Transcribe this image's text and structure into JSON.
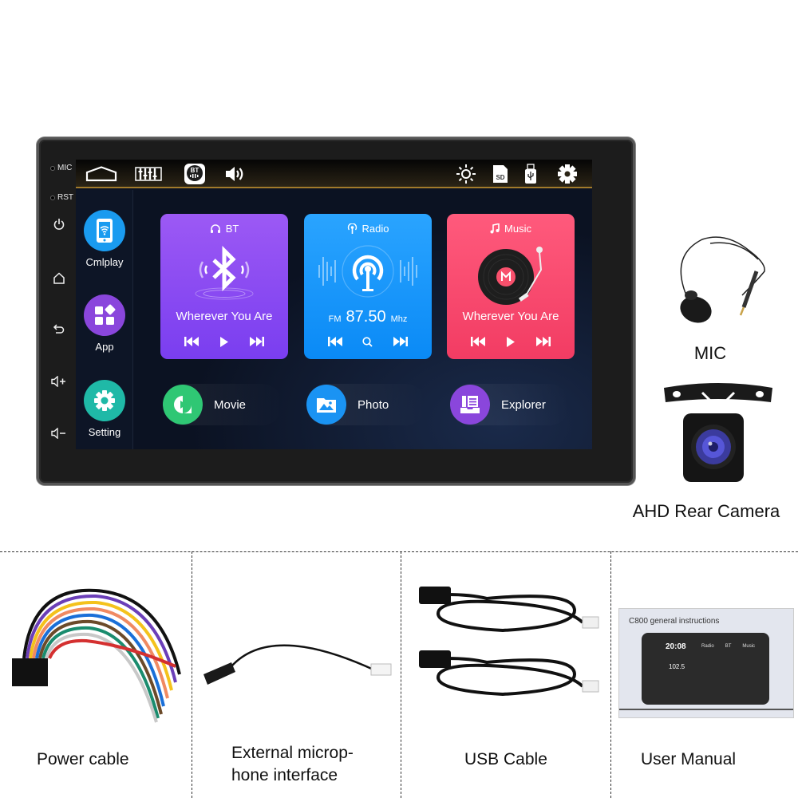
{
  "device": {
    "hardware_labels": [
      "MIC",
      "RST"
    ],
    "hardware_buttons": [
      {
        "name": "power",
        "icon": "power-icon"
      },
      {
        "name": "home",
        "icon": "home-icon"
      },
      {
        "name": "back",
        "icon": "back-icon"
      },
      {
        "name": "volume-up",
        "icon": "volume-up-icon"
      },
      {
        "name": "volume-down",
        "icon": "volume-down-icon"
      }
    ]
  },
  "statusbar": {
    "left_icons": [
      "home-outline-icon",
      "equalizer-icon",
      "bt-icon",
      "speaker-icon"
    ],
    "bt_label": "BT",
    "right_icons": [
      "brightness-icon",
      "sd-card-icon",
      "usb-icon",
      "settings-gear-icon"
    ],
    "sd_label": "SD"
  },
  "left_apps": [
    {
      "label": "Cmlplay",
      "icon": "phone-wifi-icon",
      "color": "#1a9bf0"
    },
    {
      "label": "App",
      "icon": "apps-grid-icon",
      "color": "#8a46dc"
    },
    {
      "label": "Setting",
      "icon": "gear-icon",
      "color": "#1fb9a7"
    }
  ],
  "cards": {
    "bt": {
      "header": "BT",
      "title": "Wherever You Are",
      "color": "#8a4ef3"
    },
    "radio": {
      "header": "Radio",
      "band": "FM",
      "frequency": "87.50",
      "unit": "Mhz",
      "color": "#1a98fb"
    },
    "music": {
      "header": "Music",
      "title": "Wherever You Are",
      "color": "#f64a6e"
    }
  },
  "shortcuts": [
    {
      "label": "Movie",
      "icon": "play-circle-icon",
      "color": "#2fc774"
    },
    {
      "label": "Photo",
      "icon": "image-icon",
      "color": "#1a93f3"
    },
    {
      "label": "Explorer",
      "icon": "file-list-icon",
      "color": "#8a46dc"
    }
  ],
  "accessories": {
    "mic_label": "MIC",
    "camera_label": "AHD Rear Camera"
  },
  "package_items": [
    {
      "label_lines": [
        "Power cable"
      ]
    },
    {
      "label_lines": [
        "External microp-",
        "hone interface"
      ]
    },
    {
      "label_lines": [
        "USB Cable"
      ]
    },
    {
      "label_lines": [
        "User Manual"
      ]
    }
  ],
  "manual": {
    "title": "C800 general instructions",
    "time": "20:08",
    "freq": "102.5",
    "tabs": [
      "Radio",
      "BT",
      "Music"
    ]
  }
}
